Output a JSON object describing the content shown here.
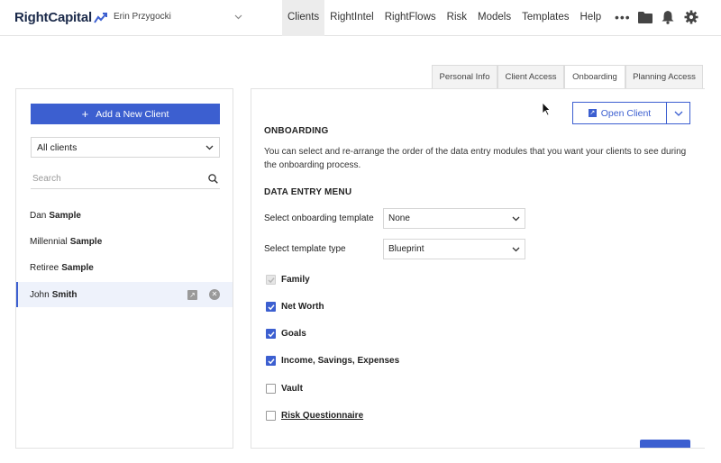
{
  "app": {
    "logo_text": "RightCapital",
    "user_name": "Erin Przygocki"
  },
  "nav": {
    "items": [
      {
        "label": "Clients",
        "active": true
      },
      {
        "label": "RightIntel",
        "active": false
      },
      {
        "label": "RightFlows",
        "active": false
      },
      {
        "label": "Risk",
        "active": false
      },
      {
        "label": "Models",
        "active": false
      },
      {
        "label": "Templates",
        "active": false
      },
      {
        "label": "Help",
        "active": false
      }
    ],
    "more_label": "•••"
  },
  "tabs": [
    {
      "label": "Personal Info",
      "active": false
    },
    {
      "label": "Client Access",
      "active": false
    },
    {
      "label": "Onboarding",
      "active": true
    },
    {
      "label": "Planning Access",
      "active": false
    }
  ],
  "sidebar": {
    "add_button_label": "Add a New Client",
    "filter_value": "All clients",
    "search_placeholder": "Search",
    "clients": [
      {
        "first": "Dan",
        "last": "Sample",
        "selected": false
      },
      {
        "first": "Millennial",
        "last": "Sample",
        "selected": false
      },
      {
        "first": "Retiree",
        "last": "Sample",
        "selected": false
      },
      {
        "first": "John",
        "last": "Smith",
        "selected": true
      }
    ]
  },
  "main": {
    "open_client_label": "Open Client",
    "onboarding_heading": "ONBOARDING",
    "onboarding_desc": "You can select and re-arrange the order of the data entry modules that you want your clients to see during the onboarding process.",
    "menu_heading": "DATA ENTRY MENU",
    "template_label": "Select onboarding template",
    "template_value": "None",
    "type_label": "Select template type",
    "type_value": "Blueprint",
    "modules": [
      {
        "label": "Family",
        "state": "disabled-checked"
      },
      {
        "label": "Net Worth",
        "state": "checked"
      },
      {
        "label": "Goals",
        "state": "checked"
      },
      {
        "label": "Income, Savings, Expenses",
        "state": "checked"
      },
      {
        "label": "Vault",
        "state": "unchecked"
      },
      {
        "label": "Risk Questionnaire",
        "state": "unchecked",
        "link": true
      }
    ]
  },
  "colors": {
    "accent": "#3c5fd0",
    "brand_dark": "#1b2a4a"
  }
}
